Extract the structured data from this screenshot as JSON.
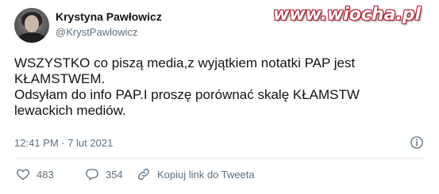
{
  "tweet": {
    "author_name": "Krystyna Pawłowicz",
    "author_handle": "@KrystPawlowicz",
    "text_lines": [
      "WSZYSTKO co piszą media,z wyjątkiem notatki PAP jest",
      "KŁAMSTWEM.",
      "Odsyłam do info PAP.I proszę porównać skalę KŁAMSTW",
      "lewackich mediów."
    ],
    "timestamp": "12:41 PM · 7 lut 2021"
  },
  "actions": {
    "like_count": "483",
    "reply_count": "354",
    "copy_link_label": "Kopiuj link do Tweeta"
  },
  "watermark": {
    "text": "www.wiocha.pl"
  },
  "icons": {
    "avatar": "profile-photo",
    "info": "info-icon",
    "like": "heart-icon",
    "reply": "comment-icon",
    "copy": "link-icon"
  },
  "colors": {
    "text_primary": "#0f1419",
    "text_secondary": "#5b7083",
    "divider": "#e6ecf0",
    "watermark_outline": "#b0192a"
  }
}
